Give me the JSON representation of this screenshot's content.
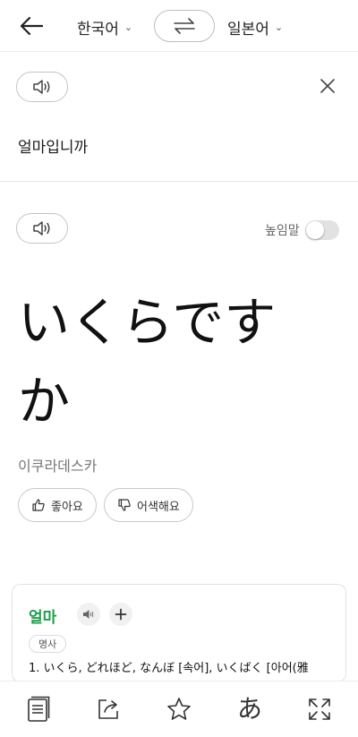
{
  "header": {
    "source_lang": "한국어",
    "target_lang": "일본어"
  },
  "source": {
    "text": "얼마입니까"
  },
  "target": {
    "honorific_label": "높임말",
    "honorific_on": false,
    "text": "いくらですか",
    "pronunciation": "이쿠라데스카",
    "like_label": "좋아요",
    "dislike_label": "어색해요"
  },
  "dictionary": {
    "word": "얼마",
    "part_of_speech": "명사",
    "definition": "1. いくら, どれほど, なんぼ [속어], いくばく [아어(雅"
  },
  "bottom_bar": {
    "hiragana_glyph": "あ"
  },
  "colors": {
    "accent_green": "#1e9f4a"
  }
}
